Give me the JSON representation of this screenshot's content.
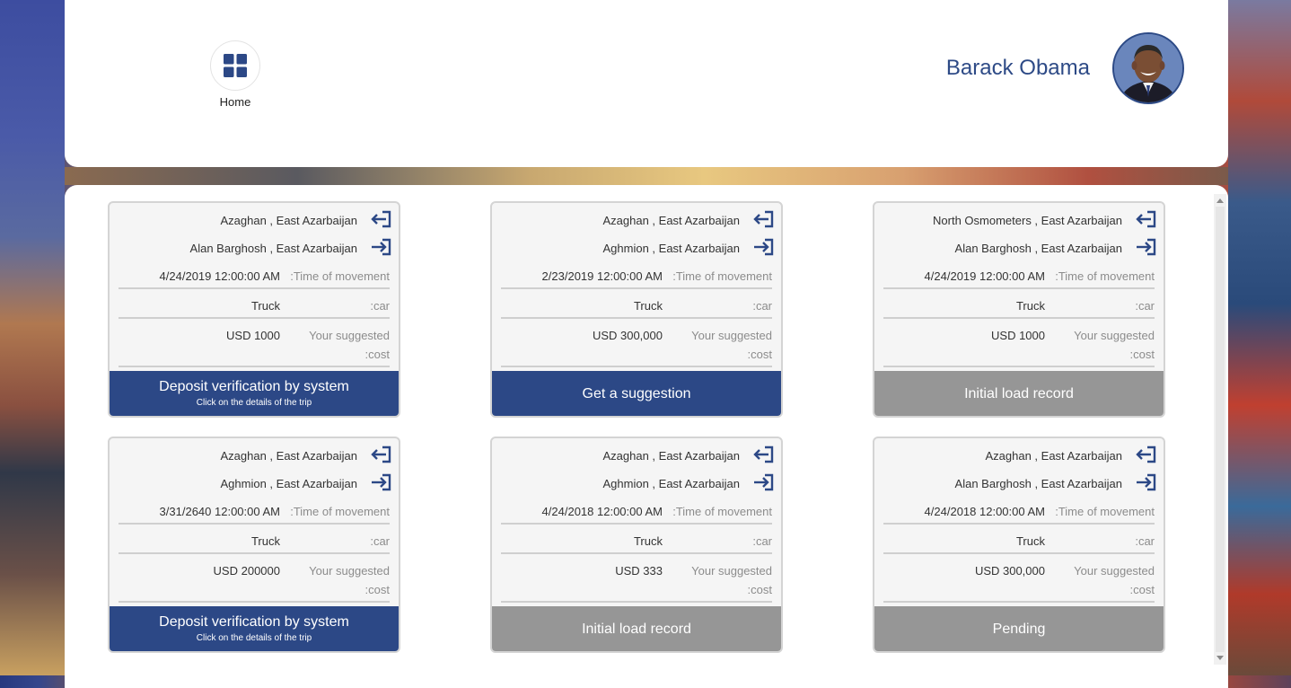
{
  "header": {
    "home_label": "Home",
    "user_name": "Barack Obama"
  },
  "cards": [
    {
      "origin": "Azaghan , East Azarbaijan",
      "destination": "Alan Barghosh , East Azarbaijan",
      "time_value": "4/24/2019 12:00:00 AM",
      "time_label": ":Time of movement",
      "car_value": "Truck",
      "car_label": ":car",
      "cost_value": "USD 1000",
      "cost_label_1": "Your suggested",
      "cost_label_2": ":cost",
      "button_label": "Deposit verification by system",
      "button_sub": "Click on the details of the trip",
      "button_style": "blue"
    },
    {
      "origin": "Azaghan , East Azarbaijan",
      "destination": "Aghmion , East Azarbaijan",
      "time_value": "2/23/2019 12:00:00 AM",
      "time_label": ":Time of movement",
      "car_value": "Truck",
      "car_label": ":car",
      "cost_value": "USD 300,000",
      "cost_label_1": "Your suggested",
      "cost_label_2": ":cost",
      "button_label": "Get a suggestion",
      "button_sub": "",
      "button_style": "blue"
    },
    {
      "origin": "North Osmometers , East Azarbaijan",
      "destination": "Alan Barghosh , East Azarbaijan",
      "time_value": "4/24/2019 12:00:00 AM",
      "time_label": ":Time of movement",
      "car_value": "Truck",
      "car_label": ":car",
      "cost_value": "USD 1000",
      "cost_label_1": "Your suggested",
      "cost_label_2": ":cost",
      "button_label": "Initial load record",
      "button_sub": "",
      "button_style": "gray"
    },
    {
      "origin": "Azaghan , East Azarbaijan",
      "destination": "Aghmion , East Azarbaijan",
      "time_value": "3/31/2640 12:00:00 AM",
      "time_label": ":Time of movement",
      "car_value": "Truck",
      "car_label": ":car",
      "cost_value": "USD 200000",
      "cost_label_1": "Your suggested",
      "cost_label_2": ":cost",
      "button_label": "Deposit verification by system",
      "button_sub": "Click on the details of the trip",
      "button_style": "blue"
    },
    {
      "origin": "Azaghan , East Azarbaijan",
      "destination": "Aghmion , East Azarbaijan",
      "time_value": "4/24/2018 12:00:00 AM",
      "time_label": ":Time of movement",
      "car_value": "Truck",
      "car_label": ":car",
      "cost_value": "USD 333",
      "cost_label_1": "Your suggested",
      "cost_label_2": ":cost",
      "button_label": "Initial load record",
      "button_sub": "",
      "button_style": "gray"
    },
    {
      "origin": "Azaghan , East Azarbaijan",
      "destination": "Alan Barghosh , East Azarbaijan",
      "time_value": "4/24/2018 12:00:00 AM",
      "time_label": ":Time of movement",
      "car_value": "Truck",
      "car_label": ":car",
      "cost_value": "USD 300,000",
      "cost_label_1": "Your suggested",
      "cost_label_2": ":cost",
      "button_label": "Pending",
      "button_sub": "",
      "button_style": "gray"
    }
  ],
  "colors": {
    "brand_blue": "#2c4886",
    "status_gray": "#969696"
  }
}
